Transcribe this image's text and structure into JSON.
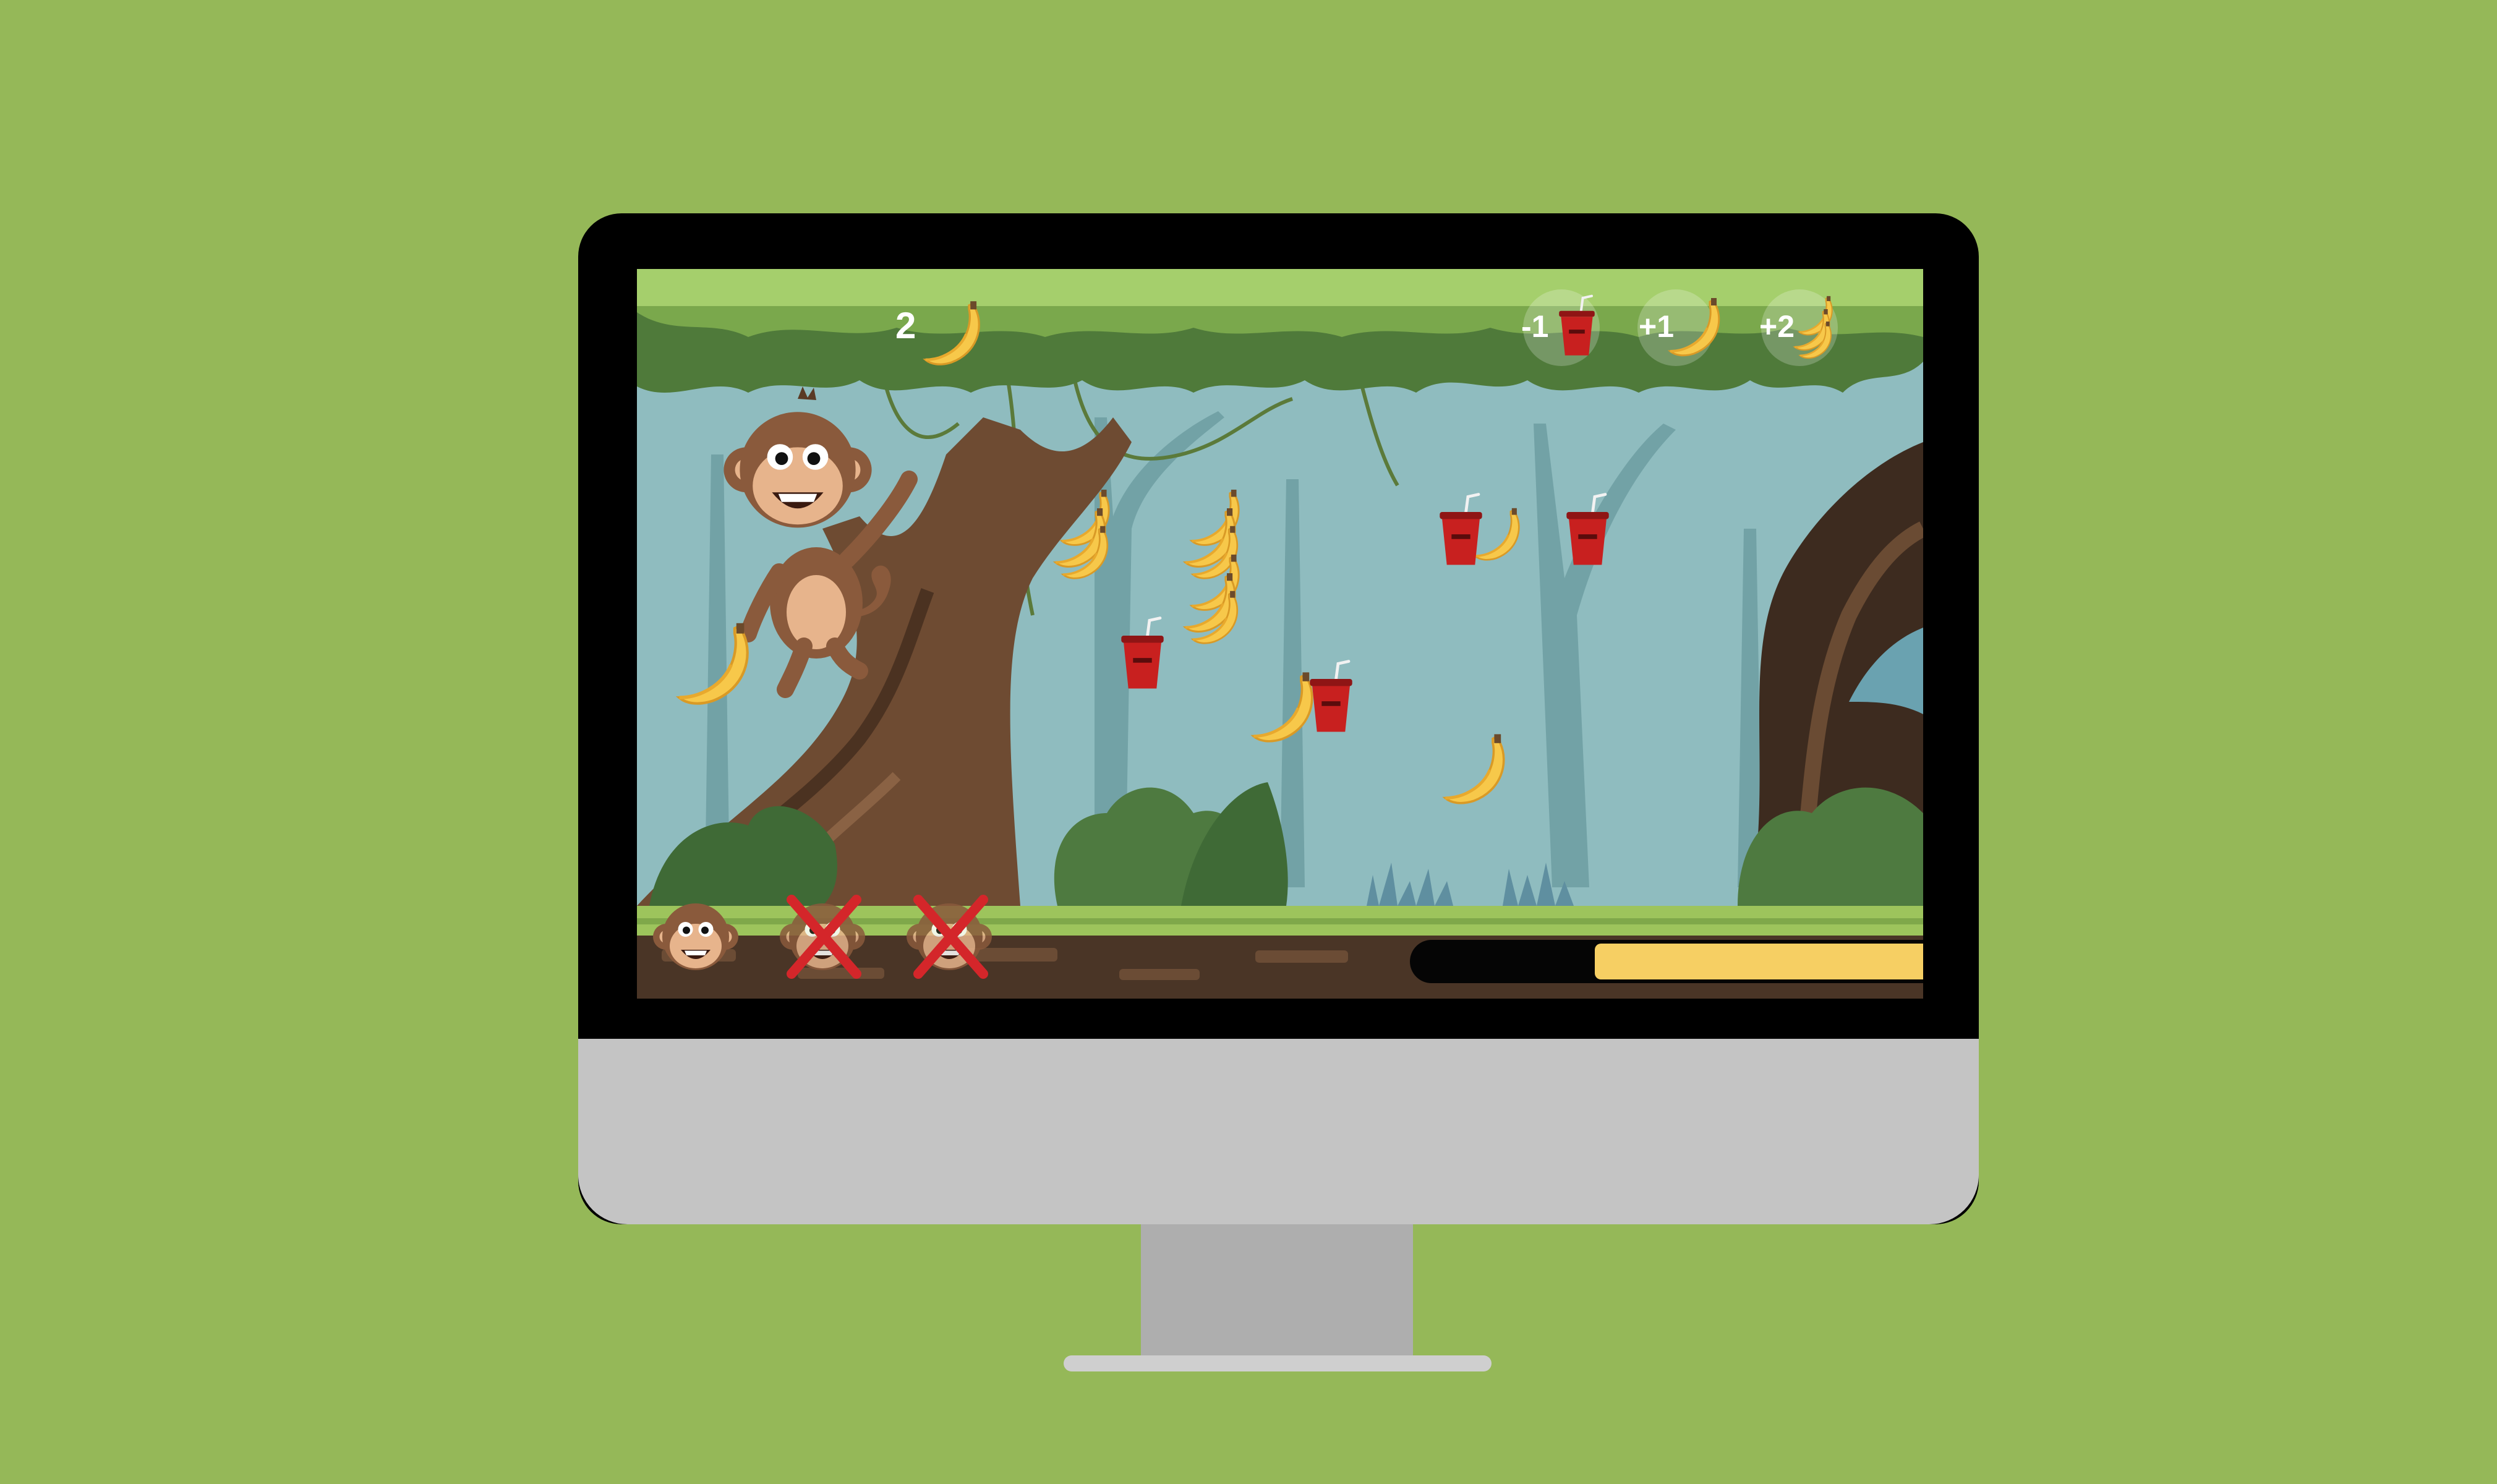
{
  "hud": {
    "banana_count": "2",
    "score_legend": [
      {
        "label": "-1",
        "item": "cup"
      },
      {
        "label": "+1",
        "item": "banana"
      },
      {
        "label": "+2",
        "item": "banana-bunch"
      }
    ]
  },
  "lives": {
    "total": 3,
    "remaining": 1
  },
  "progress": {
    "fraction": 0.64
  },
  "colors": {
    "background": "#95b858",
    "banana": "#f7c84a",
    "cup": "#c8201f",
    "progress_fill": "#f6cf63",
    "monkey": "#8a5a3c"
  },
  "icons": {
    "player": "monkey-icon",
    "good_item": "banana-icon",
    "bad_item": "soda-cup-icon",
    "lost_life": "crossed-monkey-icon"
  }
}
